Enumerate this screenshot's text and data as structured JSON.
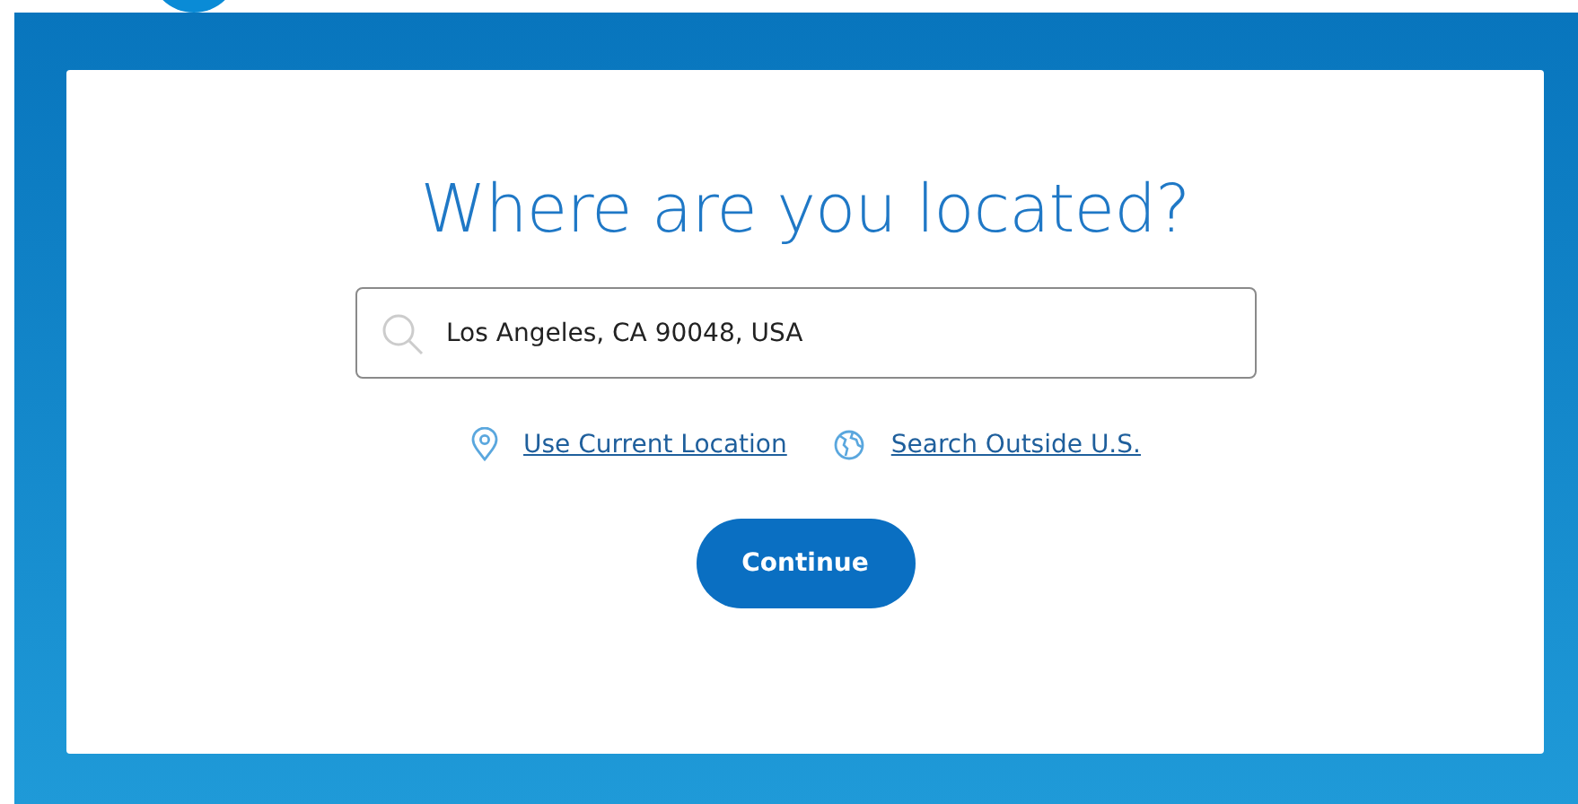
{
  "heading": "Where are you located?",
  "search": {
    "value": "Los Angeles, CA 90048, USA"
  },
  "links": [
    {
      "kind": "location",
      "label": "Use Current Location"
    },
    {
      "kind": "globe",
      "label": "Search Outside U.S."
    }
  ],
  "button": "Continue"
}
